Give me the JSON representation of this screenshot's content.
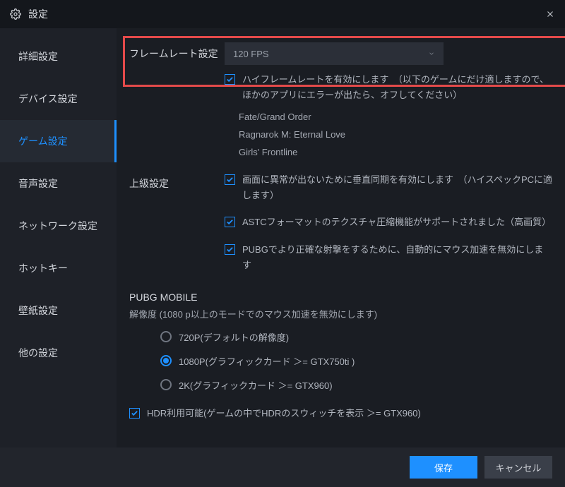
{
  "title": "設定",
  "sidebar": {
    "items": [
      {
        "label": "詳細設定"
      },
      {
        "label": "デバイス設定"
      },
      {
        "label": "ゲーム設定"
      },
      {
        "label": "音声設定"
      },
      {
        "label": "ネットワーク設定"
      },
      {
        "label": "ホットキー"
      },
      {
        "label": "壁紙設定"
      },
      {
        "label": "他の設定"
      }
    ],
    "active_index": 2
  },
  "framerate": {
    "label": "フレームレート設定",
    "value": "120 FPS",
    "high_fps_check": "ハイフレームレートを有効にします　（以下のゲームにだけ適しますので、ほかのアプリにエラーが出たら、オフしてください）",
    "games": [
      "Fate/Grand Order",
      "Ragnarok M: Eternal Love",
      "Girls' Frontline"
    ]
  },
  "advanced": {
    "label": "上級設定",
    "vsync": "画面に異常が出ないために垂直同期を有効にします　（ハイスペックPCに適します）",
    "astc": "ASTCフォーマットのテクスチャ圧縮機能がサポートされました（高画質）",
    "pubg_mouse": "PUBGでより正確な射撃をするために、自動的にマウス加速を無効にします"
  },
  "pubg": {
    "title": "PUBG MOBILE",
    "note": "解像度 (1080 p以上のモードでのマウス加速を無効にします)",
    "options": [
      {
        "label": "720P(デフォルトの解像度)"
      },
      {
        "label": "1080P(グラフィックカード ＞= GTX750ti )"
      },
      {
        "label": "2K(グラフィックカード ＞= GTX960)"
      }
    ],
    "selected_index": 1,
    "hdr": "HDR利用可能(ゲームの中でHDRのスウィッチを表示 ＞= GTX960)"
  },
  "footer": {
    "save": "保存",
    "cancel": "キャンセル"
  }
}
